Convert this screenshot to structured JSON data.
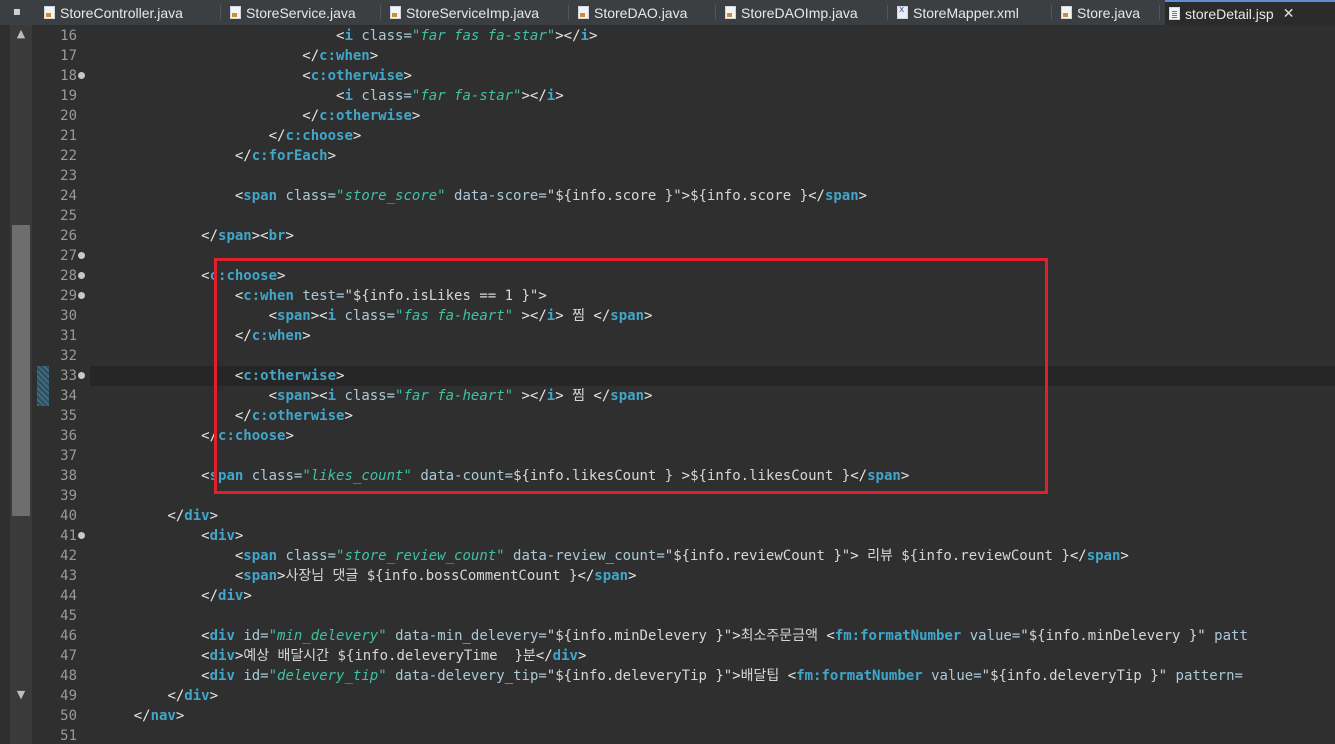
{
  "tabs": [
    {
      "label": "StoreController.java",
      "icon": "java-file-icon"
    },
    {
      "label": "StoreService.java",
      "icon": "java-file-icon"
    },
    {
      "label": "StoreServiceImp.java",
      "icon": "java-file-icon"
    },
    {
      "label": "StoreDAO.java",
      "icon": "java-file-icon"
    },
    {
      "label": "StoreDAOImp.java",
      "icon": "java-file-icon"
    },
    {
      "label": "StoreMapper.xml",
      "icon": "xml-file-icon"
    },
    {
      "label": "Store.java",
      "icon": "java-file-icon"
    },
    {
      "label": "storeDetail.jsp",
      "icon": "jsp-file-icon",
      "active": true
    }
  ],
  "close_glyph": "✕",
  "menu_glyph": "▪",
  "scroll": {
    "up": "▲",
    "down": "▼"
  },
  "colors": {
    "highlight_box": "#e0202a",
    "element": "#40a7ca",
    "string": "#3ec1a2"
  },
  "lines": [
    {
      "n": "16",
      "fold": false,
      "code": [
        [
          "t",
          "                            "
        ],
        [
          "tag",
          "<"
        ],
        [
          "el",
          "i"
        ],
        [
          "t",
          " "
        ],
        [
          "attr",
          "class="
        ],
        [
          "str",
          "\"far fas fa-star\""
        ],
        [
          "tag",
          ">"
        ],
        [
          "tag",
          "</"
        ],
        [
          "el",
          "i"
        ],
        [
          "tag",
          ">"
        ]
      ]
    },
    {
      "n": "17",
      "fold": false,
      "code": [
        [
          "t",
          "                        "
        ],
        [
          "tag",
          "</"
        ],
        [
          "el",
          "c:when"
        ],
        [
          "tag",
          ">"
        ]
      ]
    },
    {
      "n": "18",
      "fold": true,
      "code": [
        [
          "t",
          "                        "
        ],
        [
          "tag",
          "<"
        ],
        [
          "el",
          "c:otherwise"
        ],
        [
          "tag",
          ">"
        ]
      ]
    },
    {
      "n": "19",
      "fold": false,
      "code": [
        [
          "t",
          "                            "
        ],
        [
          "tag",
          "<"
        ],
        [
          "el",
          "i"
        ],
        [
          "t",
          " "
        ],
        [
          "attr",
          "class="
        ],
        [
          "str",
          "\"far fa-star\""
        ],
        [
          "tag",
          ">"
        ],
        [
          "tag",
          "</"
        ],
        [
          "el",
          "i"
        ],
        [
          "tag",
          ">"
        ]
      ]
    },
    {
      "n": "20",
      "fold": false,
      "code": [
        [
          "t",
          "                        "
        ],
        [
          "tag",
          "</"
        ],
        [
          "el",
          "c:otherwise"
        ],
        [
          "tag",
          ">"
        ]
      ]
    },
    {
      "n": "21",
      "fold": false,
      "code": [
        [
          "t",
          "                    "
        ],
        [
          "tag",
          "</"
        ],
        [
          "el",
          "c:choose"
        ],
        [
          "tag",
          ">"
        ]
      ]
    },
    {
      "n": "22",
      "fold": false,
      "code": [
        [
          "t",
          "                "
        ],
        [
          "tag",
          "</"
        ],
        [
          "el",
          "c:forEach"
        ],
        [
          "tag",
          ">"
        ]
      ]
    },
    {
      "n": "23",
      "fold": false,
      "code": []
    },
    {
      "n": "24",
      "fold": false,
      "code": [
        [
          "t",
          "                "
        ],
        [
          "tag",
          "<"
        ],
        [
          "el",
          "span"
        ],
        [
          "t",
          " "
        ],
        [
          "attr",
          "class="
        ],
        [
          "str",
          "\"store_score\""
        ],
        [
          "t",
          " "
        ],
        [
          "attr",
          "data-score="
        ],
        [
          "txt",
          "\"${info.score }\""
        ],
        [
          "tag",
          ">"
        ],
        [
          "txt",
          "${info.score }"
        ],
        [
          "tag",
          "</"
        ],
        [
          "el",
          "span"
        ],
        [
          "tag",
          ">"
        ]
      ]
    },
    {
      "n": "25",
      "fold": false,
      "code": []
    },
    {
      "n": "26",
      "fold": false,
      "code": [
        [
          "t",
          "            "
        ],
        [
          "tag",
          "</"
        ],
        [
          "el",
          "span"
        ],
        [
          "tag",
          "><"
        ],
        [
          "el",
          "br"
        ],
        [
          "tag",
          ">"
        ]
      ]
    },
    {
      "n": "27",
      "fold": true,
      "code": []
    },
    {
      "n": "28",
      "fold": true,
      "code": [
        [
          "t",
          "            "
        ],
        [
          "tag",
          "<"
        ],
        [
          "el",
          "c:choose"
        ],
        [
          "tag",
          ">"
        ]
      ]
    },
    {
      "n": "29",
      "fold": true,
      "code": [
        [
          "t",
          "                "
        ],
        [
          "tag",
          "<"
        ],
        [
          "el",
          "c:when"
        ],
        [
          "t",
          " "
        ],
        [
          "attr",
          "test="
        ],
        [
          "txt",
          "\"${info.isLikes == 1 }\""
        ],
        [
          "tag",
          ">"
        ]
      ]
    },
    {
      "n": "30",
      "fold": false,
      "code": [
        [
          "t",
          "                    "
        ],
        [
          "tag",
          "<"
        ],
        [
          "el",
          "span"
        ],
        [
          "tag",
          "><"
        ],
        [
          "el",
          "i"
        ],
        [
          "t",
          " "
        ],
        [
          "attr",
          "class="
        ],
        [
          "str",
          "\"fas fa-heart\""
        ],
        [
          "t",
          " "
        ],
        [
          "tag",
          "></"
        ],
        [
          "el",
          "i"
        ],
        [
          "tag",
          ">"
        ],
        [
          "txt",
          " 찜 "
        ],
        [
          "tag",
          "</"
        ],
        [
          "el",
          "span"
        ],
        [
          "tag",
          ">"
        ]
      ]
    },
    {
      "n": "31",
      "fold": false,
      "code": [
        [
          "t",
          "                "
        ],
        [
          "tag",
          "</"
        ],
        [
          "el",
          "c:when"
        ],
        [
          "tag",
          ">"
        ]
      ]
    },
    {
      "n": "32",
      "fold": false,
      "code": []
    },
    {
      "n": "33",
      "fold": true,
      "cur": true,
      "code": [
        [
          "t",
          "                "
        ],
        [
          "tag",
          "<"
        ],
        [
          "el",
          "c:otherwise"
        ],
        [
          "tag",
          ">"
        ]
      ]
    },
    {
      "n": "34",
      "fold": false,
      "code": [
        [
          "t",
          "                    "
        ],
        [
          "tag",
          "<"
        ],
        [
          "el",
          "span"
        ],
        [
          "tag",
          "><"
        ],
        [
          "el",
          "i"
        ],
        [
          "t",
          " "
        ],
        [
          "attr",
          "class="
        ],
        [
          "str",
          "\"far fa-heart\""
        ],
        [
          "t",
          " "
        ],
        [
          "tag",
          "></"
        ],
        [
          "el",
          "i"
        ],
        [
          "tag",
          ">"
        ],
        [
          "txt",
          " 찜 "
        ],
        [
          "tag",
          "</"
        ],
        [
          "el",
          "span"
        ],
        [
          "tag",
          ">"
        ]
      ]
    },
    {
      "n": "35",
      "fold": false,
      "code": [
        [
          "t",
          "                "
        ],
        [
          "tag",
          "</"
        ],
        [
          "el",
          "c:otherwise"
        ],
        [
          "tag",
          ">"
        ]
      ]
    },
    {
      "n": "36",
      "fold": false,
      "code": [
        [
          "t",
          "            "
        ],
        [
          "tag",
          "</"
        ],
        [
          "el",
          "c:choose"
        ],
        [
          "tag",
          ">"
        ]
      ]
    },
    {
      "n": "37",
      "fold": false,
      "code": []
    },
    {
      "n": "38",
      "fold": false,
      "code": [
        [
          "t",
          "            "
        ],
        [
          "tag",
          "<"
        ],
        [
          "el",
          "span"
        ],
        [
          "t",
          " "
        ],
        [
          "attr",
          "class="
        ],
        [
          "str",
          "\"likes_count\""
        ],
        [
          "t",
          " "
        ],
        [
          "attr",
          "data-count="
        ],
        [
          "txt",
          "${info.likesCount }"
        ],
        [
          "t",
          " "
        ],
        [
          "tag",
          ">"
        ],
        [
          "txt",
          "${info.likesCount }"
        ],
        [
          "tag",
          "</"
        ],
        [
          "el",
          "span"
        ],
        [
          "tag",
          ">"
        ]
      ]
    },
    {
      "n": "39",
      "fold": false,
      "code": []
    },
    {
      "n": "40",
      "fold": false,
      "code": [
        [
          "t",
          "        "
        ],
        [
          "tag",
          "</"
        ],
        [
          "el",
          "div"
        ],
        [
          "tag",
          ">"
        ]
      ]
    },
    {
      "n": "41",
      "fold": true,
      "code": [
        [
          "t",
          "            "
        ],
        [
          "tag",
          "<"
        ],
        [
          "el",
          "div"
        ],
        [
          "tag",
          ">"
        ]
      ]
    },
    {
      "n": "42",
      "fold": false,
      "code": [
        [
          "t",
          "                "
        ],
        [
          "tag",
          "<"
        ],
        [
          "el",
          "span"
        ],
        [
          "t",
          " "
        ],
        [
          "attr",
          "class="
        ],
        [
          "str",
          "\"store_review_count\""
        ],
        [
          "t",
          " "
        ],
        [
          "attr",
          "data-review_count="
        ],
        [
          "txt",
          "\"${info.reviewCount }\""
        ],
        [
          "tag",
          ">"
        ],
        [
          "txt",
          " 리뷰 ${info.reviewCount }"
        ],
        [
          "tag",
          "</"
        ],
        [
          "el",
          "span"
        ],
        [
          "tag",
          ">"
        ]
      ]
    },
    {
      "n": "43",
      "fold": false,
      "code": [
        [
          "t",
          "                "
        ],
        [
          "tag",
          "<"
        ],
        [
          "el",
          "span"
        ],
        [
          "tag",
          ">"
        ],
        [
          "txt",
          "사장님 댓글 ${info.bossCommentCount }"
        ],
        [
          "tag",
          "</"
        ],
        [
          "el",
          "span"
        ],
        [
          "tag",
          ">"
        ]
      ]
    },
    {
      "n": "44",
      "fold": false,
      "code": [
        [
          "t",
          "            "
        ],
        [
          "tag",
          "</"
        ],
        [
          "el",
          "div"
        ],
        [
          "tag",
          ">"
        ]
      ]
    },
    {
      "n": "45",
      "fold": false,
      "code": []
    },
    {
      "n": "46",
      "fold": false,
      "code": [
        [
          "t",
          "            "
        ],
        [
          "tag",
          "<"
        ],
        [
          "el",
          "div"
        ],
        [
          "t",
          " "
        ],
        [
          "attr",
          "id="
        ],
        [
          "str",
          "\"min_delevery\""
        ],
        [
          "t",
          " "
        ],
        [
          "attr",
          "data-min_delevery="
        ],
        [
          "txt",
          "\"${info.minDelevery }\""
        ],
        [
          "tag",
          ">"
        ],
        [
          "txt",
          "최소주문금액 "
        ],
        [
          "tag",
          "<"
        ],
        [
          "el",
          "fm:formatNumber"
        ],
        [
          "t",
          " "
        ],
        [
          "attr",
          "value="
        ],
        [
          "txt",
          "\"${info.minDelevery }\""
        ],
        [
          "t",
          " "
        ],
        [
          "attr",
          "patt"
        ]
      ]
    },
    {
      "n": "47",
      "fold": false,
      "code": [
        [
          "t",
          "            "
        ],
        [
          "tag",
          "<"
        ],
        [
          "el",
          "div"
        ],
        [
          "tag",
          ">"
        ],
        [
          "txt",
          "예상 배달시간 ${info.deleveryTime  }분"
        ],
        [
          "tag",
          "</"
        ],
        [
          "el",
          "div"
        ],
        [
          "tag",
          ">"
        ]
      ]
    },
    {
      "n": "48",
      "fold": false,
      "code": [
        [
          "t",
          "            "
        ],
        [
          "tag",
          "<"
        ],
        [
          "el",
          "div"
        ],
        [
          "t",
          " "
        ],
        [
          "attr",
          "id="
        ],
        [
          "str",
          "\"delevery_tip\""
        ],
        [
          "t",
          " "
        ],
        [
          "attr",
          "data-delevery_tip="
        ],
        [
          "txt",
          "\"${info.deleveryTip }\""
        ],
        [
          "tag",
          ">"
        ],
        [
          "txt",
          "배달팁 "
        ],
        [
          "tag",
          "<"
        ],
        [
          "el",
          "fm:formatNumber"
        ],
        [
          "t",
          " "
        ],
        [
          "attr",
          "value="
        ],
        [
          "txt",
          "\"${info.deleveryTip }\""
        ],
        [
          "t",
          " "
        ],
        [
          "attr",
          "pattern="
        ]
      ]
    },
    {
      "n": "49",
      "fold": false,
      "code": [
        [
          "t",
          "        "
        ],
        [
          "tag",
          "</"
        ],
        [
          "el",
          "div"
        ],
        [
          "tag",
          ">"
        ]
      ]
    },
    {
      "n": "50",
      "fold": false,
      "code": [
        [
          "t",
          "    "
        ],
        [
          "tag",
          "</"
        ],
        [
          "el",
          "nav"
        ],
        [
          "tag",
          ">"
        ]
      ]
    },
    {
      "n": "51",
      "fold": false,
      "code": []
    }
  ]
}
